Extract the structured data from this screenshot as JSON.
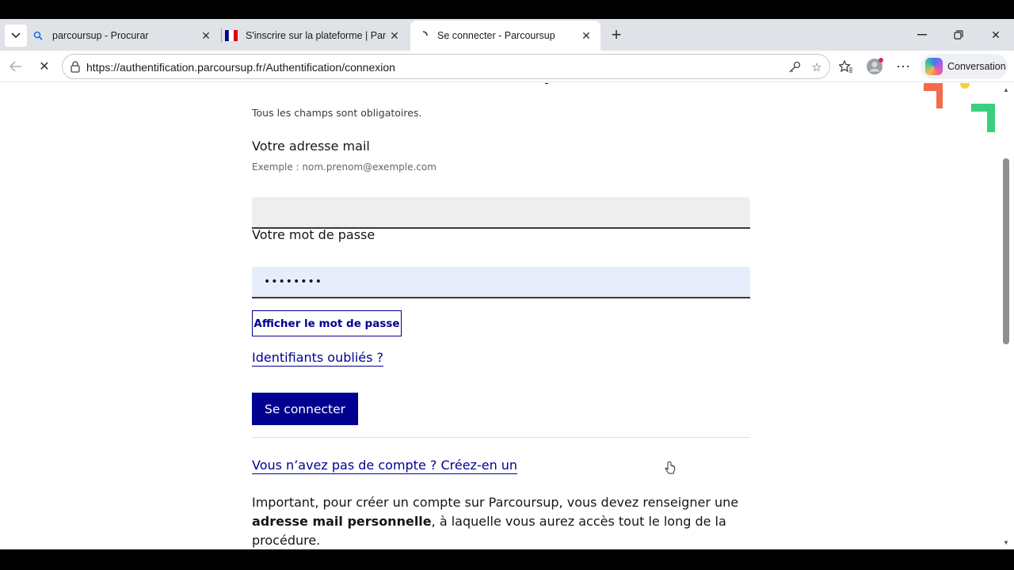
{
  "browser": {
    "tabs": [
      {
        "title": "parcoursup - Procurar",
        "favicon": "search-icon"
      },
      {
        "title": "S'inscrire sur la plateforme | Parco",
        "favicon": "flag-icon"
      },
      {
        "title": "Se connecter - Parcoursup",
        "favicon": "loading-icon"
      }
    ],
    "url": "https://authentification.parcoursup.fr/Authentification/connexion",
    "copilot_label": "Conversation",
    "accent": "#000091"
  },
  "form": {
    "required_note": "Tous les champs sont obligatoires.",
    "email_label": "Votre adresse mail",
    "email_hint": "Exemple : nom.prenom@exemple.com",
    "email_value": "",
    "password_label": "Votre mot de passe",
    "password_value": "••••••••",
    "show_password": "Afficher le mot de passe",
    "forgot_link": "Identifiants oubliés ?",
    "submit": "Se connecter",
    "create_account_link": "Vous n’avez pas de compte ? Créez-en un",
    "important_pre": "Important, pour créer un compte sur Parcoursup, vous devez renseigner une ",
    "important_bold": "adresse mail personnelle",
    "important_post": ", à laquelle vous aurez accès tout le long de la procédure."
  }
}
